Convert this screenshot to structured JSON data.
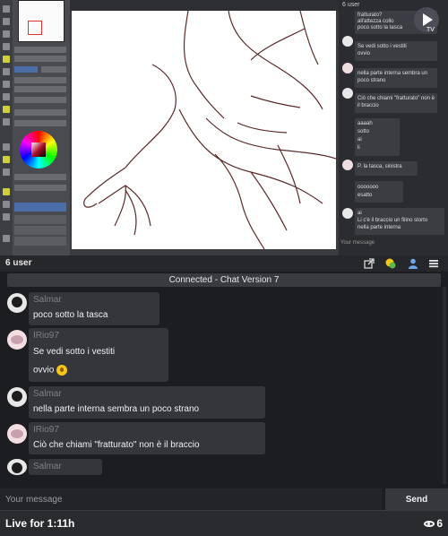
{
  "stream": {
    "logo_text": "TV",
    "mini_chat": {
      "title": "6 user",
      "messages": [
        {
          "text": "fratturato?"
        },
        {
          "text": "all'attezza collo"
        },
        {
          "text": "poco sotto la tasca"
        },
        {
          "text": "Se vedi sotto i vestiti"
        },
        {
          "text": "ovvio"
        },
        {
          "text": "nella parte interna sembra un poco strano"
        },
        {
          "text": "Ciò che chiami \"fratturato\" non è il braccio"
        },
        {
          "text": "aaaah"
        },
        {
          "text": "sotto"
        },
        {
          "text": "ai"
        },
        {
          "text": "li"
        },
        {
          "text": "P. la tasca, sinistra"
        },
        {
          "text": "ooooooo"
        },
        {
          "text": "esatto"
        },
        {
          "text": "ai"
        },
        {
          "text": "Li c'è il braccio un filino storto"
        },
        {
          "text": "nella parte interna"
        }
      ],
      "input_placeholder": "Your message"
    }
  },
  "chat": {
    "user_count": "6 user",
    "status": "Connected - Chat Version 7",
    "messages": [
      {
        "user": "Salmar",
        "avatar": "skull-avatar",
        "lines": [
          "poco sotto la tasca"
        ]
      },
      {
        "user": "IRio97",
        "avatar": "anime-avatar",
        "lines": [
          "Se vedi sotto i vestiti",
          "ovvio"
        ],
        "emoji": "winking-emoji-icon"
      },
      {
        "user": "Salmar",
        "avatar": "skull-avatar",
        "lines": [
          "nella parte interna sembra un poco strano"
        ]
      },
      {
        "user": "IRio97",
        "avatar": "anime-avatar",
        "lines": [
          "Ciò che chiami \"fratturato\" non è il braccio"
        ]
      },
      {
        "user": "Salmar",
        "avatar": "skull-avatar",
        "lines": []
      }
    ],
    "input_placeholder": "Your message",
    "send_label": "Send"
  },
  "footer": {
    "live_label": "Live for 1:11h",
    "viewers": "6"
  },
  "icons": [
    "share-icon",
    "emoji-icon",
    "users-icon",
    "menu-icon",
    "eye-icon"
  ],
  "colors": {
    "background": "#1c1d20",
    "message_bg": "#35363b",
    "username": "#7f8087"
  }
}
